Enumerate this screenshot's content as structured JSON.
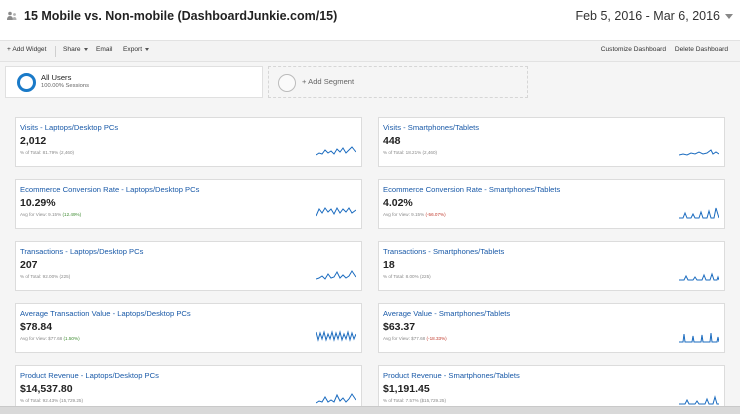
{
  "header": {
    "title": "15 Mobile vs. Non-mobile (DashboardJunkie.com/15)",
    "date_range": "Feb 5, 2016 - Mar 6, 2016"
  },
  "toolbar": {
    "add_widget": "+ Add Widget",
    "share": "Share",
    "email": "Email",
    "export": "Export",
    "customize": "Customize Dashboard",
    "delete": "Delete Dashboard"
  },
  "segments": {
    "active": {
      "name": "All Users",
      "sub": "100.00% Sessions"
    },
    "add_label": "+ Add Segment"
  },
  "widgets": [
    {
      "title": "Visits - Laptops/Desktop PCs",
      "value": "2,012",
      "sub": "% of Total: 81.79% (2,460)",
      "delta": "",
      "delta_type": ""
    },
    {
      "title": "Visits - Smartphones/Tablets",
      "value": "448",
      "sub": "% of Total: 18.21% (2,460)",
      "delta": "",
      "delta_type": ""
    },
    {
      "title": "Ecommerce Conversion Rate - Laptops/Desktop PCs",
      "value": "10.29%",
      "sub": "Avg for View: 9.15%",
      "delta": "(12.49%)",
      "delta_type": "pos"
    },
    {
      "title": "Ecommerce Conversion Rate - Smartphones/Tablets",
      "value": "4.02%",
      "sub": "Avg for View: 9.15%",
      "delta": "(-56.07%)",
      "delta_type": "neg"
    },
    {
      "title": "Transactions - Laptops/Desktop PCs",
      "value": "207",
      "sub": "% of Total: 92.00% (225)",
      "delta": "",
      "delta_type": ""
    },
    {
      "title": "Transactions - Smartphones/Tablets",
      "value": "18",
      "sub": "% of Total: 8.00% (225)",
      "delta": "",
      "delta_type": ""
    },
    {
      "title": "Average Transaction Value - Laptops/Desktop PCs",
      "value": "$78.84",
      "sub": "Avg for View: $77.68",
      "delta": "(1.50%)",
      "delta_type": "pos"
    },
    {
      "title": "Average Value - Smartphones/Tablets",
      "value": "$63.37",
      "sub": "Avg for View: $77.68",
      "delta": "(-18.33%)",
      "delta_type": "neg"
    },
    {
      "title": "Product Revenue - Laptops/Desktop PCs",
      "value": "$14,537.80",
      "sub": "% of Total: 92.43% (15,729.25)",
      "delta": "",
      "delta_type": ""
    },
    {
      "title": "Product Revenue - Smartphones/Tablets",
      "value": "$1,191.45",
      "sub": "% of Total: 7.57% ($15,729.25)",
      "delta": "",
      "delta_type": ""
    }
  ],
  "colors": {
    "link_blue": "#1a5aa8",
    "sparkline": "#1a6bbf",
    "positive": "#3c8a2e",
    "negative": "#c0392b",
    "segment_ring": "#1a7ac8"
  },
  "icons": {
    "header": "people-icon",
    "date_dropdown": "chevron-down-icon",
    "segment": "segment-ring-icon",
    "add_segment": "add-segment-ring-icon"
  }
}
